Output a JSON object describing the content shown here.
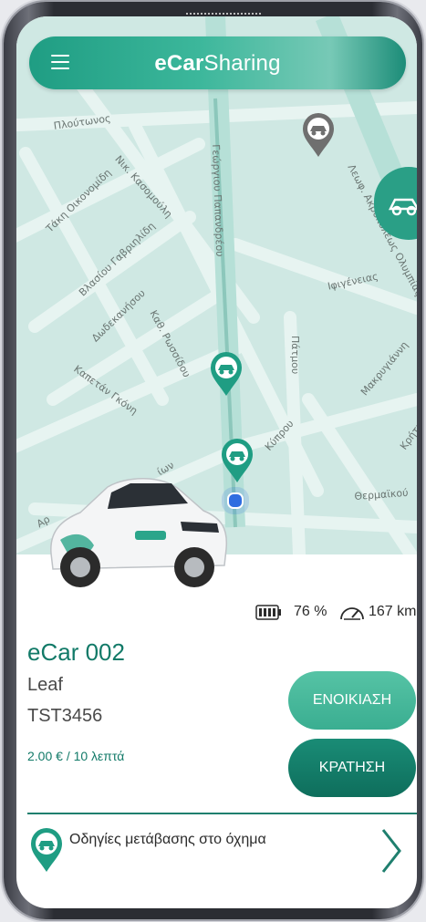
{
  "header": {
    "brand_prefix": "eCar",
    "brand_suffix": "Sharing"
  },
  "map": {
    "streets": [
      "Πλούτωνος",
      "Τάκη Οικονομίδη",
      "Νικ. Κασομούλη",
      "Βλασίου Γαβριηλίδη",
      "Δωδεκανήσου",
      "Καθ. Ρωσσίδου",
      "Καπετάν Γκόνη",
      "Γεώργιου Παπανδρέου",
      "Πάτμου",
      "Ιφιγένειας",
      "Κύπρου",
      "Μακρυγιάννη",
      "Λεωφ. Ακροπόλεως Ολυμπίας",
      "Θερμαϊκού",
      "Κρήτης",
      "Αρ",
      "ίων"
    ]
  },
  "vehicle": {
    "battery_percent": "76 %",
    "range": "167 km",
    "name": "eCar 002",
    "model": "Leaf",
    "plate": "TST3456",
    "price": "2.00 € / 10 λεπτά"
  },
  "actions": {
    "rent_label": "ΕΝΟΙΚΙΑΣΗ",
    "book_label": "ΚΡΑΤΗΣΗ"
  },
  "directions": {
    "label": "Οδηγίες μετάβασης στο όχημα"
  },
  "colors": {
    "accent": "#1f9d83",
    "dark_accent": "#0e6e5c",
    "map": "#cfe8e3"
  },
  "icons": [
    "menu-icon",
    "car-pin-icon",
    "location-dot-icon",
    "battery-icon",
    "speedometer-icon",
    "chevron-right-icon"
  ]
}
